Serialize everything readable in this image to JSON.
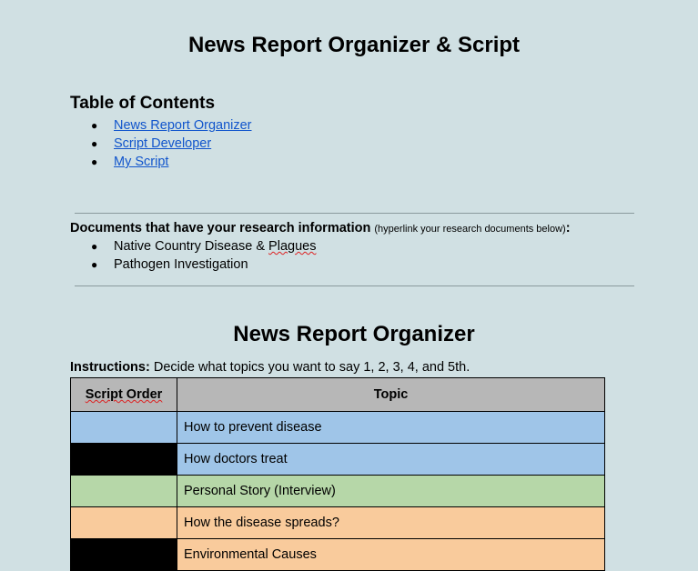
{
  "document": {
    "title": "News Report Organizer & Script"
  },
  "toc": {
    "heading": "Table of Contents",
    "items": [
      {
        "label": "News Report Organizer"
      },
      {
        "label": "Script Developer"
      },
      {
        "label": "My Script"
      }
    ]
  },
  "research": {
    "heading": "Documents that have your research information",
    "note": "(hyperlink your research documents below)",
    "colon": ":",
    "items": [
      {
        "label_prefix": "Native Country Disease & ",
        "label_flagged": "Plagues"
      },
      {
        "label": "Pathogen Investigation"
      }
    ]
  },
  "organizer": {
    "title": "News Report Organizer",
    "instructions_label": "Instructions:",
    "instructions_text": " Decide what topics you want to say 1, 2, 3, 4, and 5th.",
    "columns": {
      "order": "Script Order",
      "topic": "Topic"
    },
    "rows": [
      {
        "order": "",
        "topic": "How to prevent disease",
        "order_color": "#9fc5e8",
        "topic_color": "#9fc5e8"
      },
      {
        "order": "",
        "topic": "How doctors treat",
        "order_color": "#000000",
        "topic_color": "#9fc5e8"
      },
      {
        "order": "",
        "topic": "Personal Story (Interview)",
        "order_color": "#b6d7a8",
        "topic_color": "#b6d7a8"
      },
      {
        "order": "",
        "topic": "How the disease spreads?",
        "order_color": "#f9cb9c",
        "topic_color": "#f9cb9c"
      },
      {
        "order": "",
        "topic": "Environmental Causes",
        "order_color": "#000000",
        "topic_color": "#f9cb9c"
      }
    ]
  },
  "colors": {
    "page_background": "#d0e0e3",
    "link": "#1155cc",
    "header_row": "#b7b7b7"
  }
}
